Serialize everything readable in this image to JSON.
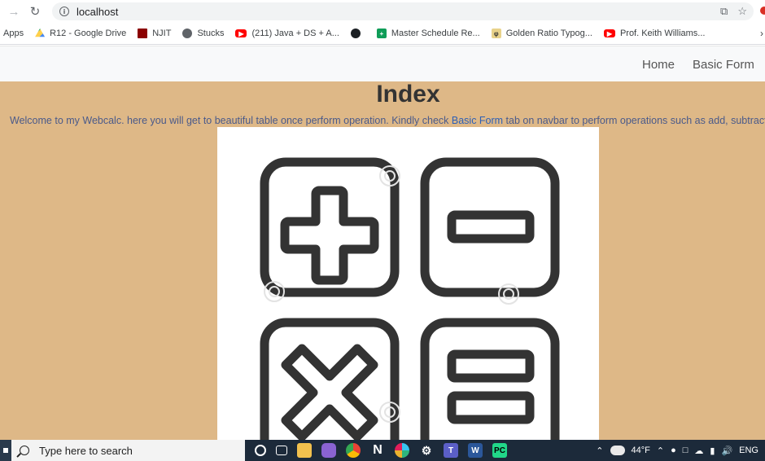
{
  "browser": {
    "url": "localhost",
    "bookmarks": [
      {
        "label": "Apps",
        "icon": "apps-grid-icon"
      },
      {
        "label": "R12 - Google Drive",
        "icon": "google-drive-icon"
      },
      {
        "label": "NJIT",
        "icon": "njit-icon"
      },
      {
        "label": "Stucks",
        "icon": "globe-icon"
      },
      {
        "label": "(211) Java + DS + A...",
        "icon": "youtube-icon"
      },
      {
        "label": "",
        "icon": "github-icon"
      },
      {
        "label": "Master Schedule Re...",
        "icon": "google-sheets-icon"
      },
      {
        "label": "Golden Ratio Typog...",
        "icon": "golden-ratio-icon"
      },
      {
        "label": "Prof. Keith Williams...",
        "icon": "youtube-icon"
      }
    ],
    "more_label": "›"
  },
  "navbar": {
    "home": "Home",
    "basic_form": "Basic Form"
  },
  "page": {
    "title": "Index",
    "welcome_pre": "Welcome to my Webcalc. here you will get to beautiful table once perform operation. Kindly check ",
    "welcome_link": "Basic Form",
    "welcome_post": " tab on navbar to perform operations such as add, subtract, multiply a",
    "image_colors": {
      "stroke": "#333333",
      "watermark": "#e8e8e8"
    }
  },
  "taskbar": {
    "search_placeholder": "Type here to search",
    "temperature": "44°F",
    "language": "ENG"
  },
  "colors": {
    "page_background": "#deb887",
    "navbar_background": "#f8f9fa",
    "taskbar_background": "#1c2a3a"
  }
}
